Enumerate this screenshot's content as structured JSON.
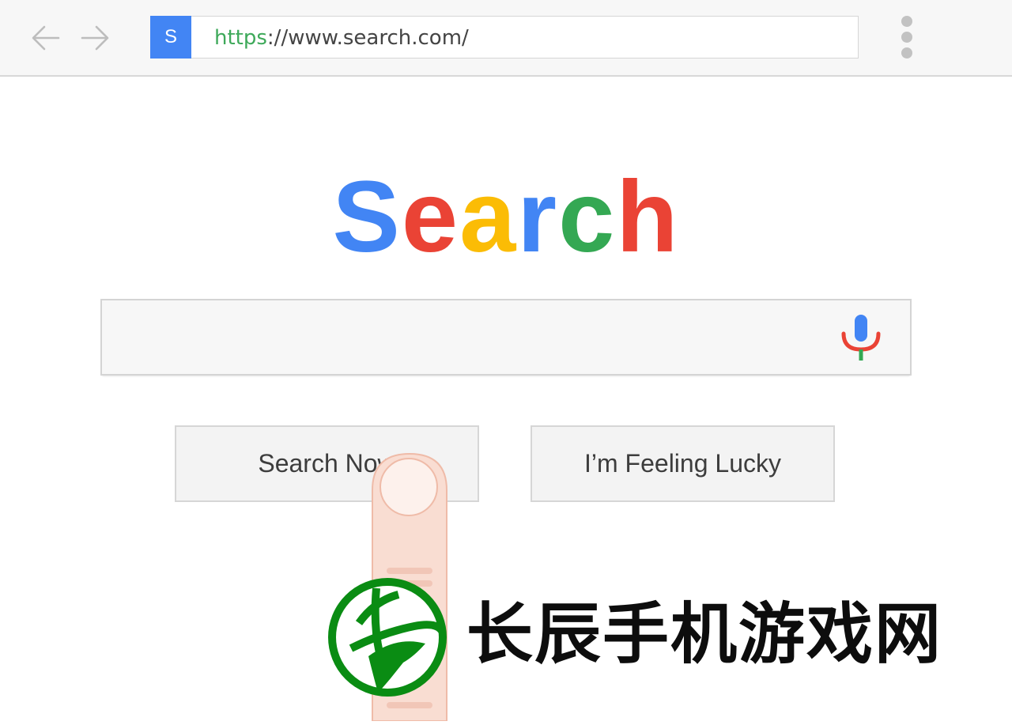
{
  "browser": {
    "back_icon": "arrow-left-icon",
    "forward_icon": "arrow-right-icon",
    "favicon_letter": "S",
    "favicon_color": "#4285f4",
    "url_scheme": "https",
    "url_rest": "://www.search.com/",
    "menu_icon": "more-vertical-icon"
  },
  "logo": {
    "letters": [
      {
        "char": "S",
        "color": "#4285f4"
      },
      {
        "char": "e",
        "color": "#ea4335"
      },
      {
        "char": "a",
        "color": "#fbbc05"
      },
      {
        "char": "r",
        "color": "#4285f4"
      },
      {
        "char": "c",
        "color": "#34a853"
      },
      {
        "char": "h",
        "color": "#ea4335"
      }
    ]
  },
  "search": {
    "value": "",
    "placeholder": "",
    "mic_icon": "microphone-icon"
  },
  "buttons": {
    "search_label": "Search Now",
    "lucky_label": "I’m Feeling Lucky"
  },
  "watermark": {
    "text": "长辰手机游戏网",
    "logo_icon": "site-logo-icon",
    "logo_color": "#0a8c13"
  }
}
